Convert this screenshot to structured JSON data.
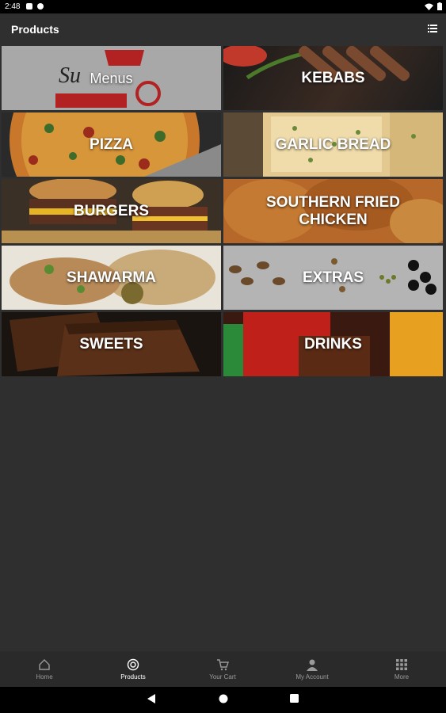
{
  "status_bar": {
    "time": "2:48"
  },
  "app_bar": {
    "title": "Products"
  },
  "categories": [
    {
      "label": "Menus"
    },
    {
      "label": "KEBABS"
    },
    {
      "label": "PIZZA"
    },
    {
      "label": "GARLIC BREAD"
    },
    {
      "label": "BURGERS"
    },
    {
      "label": "SOUTHERN FRIED\nCHICKEN"
    },
    {
      "label": "SHAWARMA"
    },
    {
      "label": "EXTRAS"
    },
    {
      "label": "SWEETS"
    },
    {
      "label": "DRINKS"
    }
  ],
  "bottom_nav": [
    {
      "label": "Home",
      "icon": "home-icon"
    },
    {
      "label": "Products",
      "icon": "products-icon",
      "active": true
    },
    {
      "label": "Your Cart",
      "icon": "cart-icon"
    },
    {
      "label": "My Account",
      "icon": "account-icon"
    },
    {
      "label": "More",
      "icon": "grid-icon"
    }
  ]
}
